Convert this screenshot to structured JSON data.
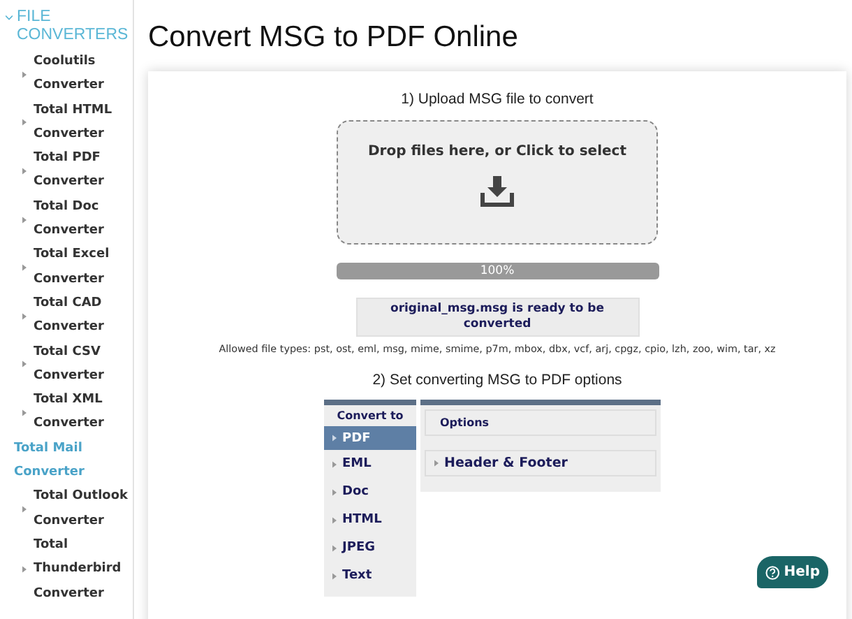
{
  "sidebar": {
    "title": "FILE CONVERTERS",
    "expanded": true,
    "children": [
      {
        "kind": "item",
        "label": "Coolutils Converter"
      },
      {
        "kind": "item",
        "label": "Total HTML Converter"
      },
      {
        "kind": "item",
        "label": "Total PDF Converter"
      },
      {
        "kind": "item",
        "label": "Total Doc Converter"
      },
      {
        "kind": "item",
        "label": "Total Excel Converter"
      },
      {
        "kind": "item",
        "label": "Total CAD Converter"
      },
      {
        "kind": "item",
        "label": "Total CSV Converter"
      },
      {
        "kind": "item",
        "label": "Total XML Converter"
      },
      {
        "kind": "category",
        "label": "Total Mail Converter",
        "children": [
          {
            "kind": "item",
            "label": "Total Outlook Converter"
          },
          {
            "kind": "item",
            "label": "Total Thunderbird Converter"
          }
        ]
      }
    ]
  },
  "page_title": "Convert MSG to PDF Online",
  "upload": {
    "heading": "1) Upload MSG file to convert",
    "dropzone_text": "Drop files here, or Click to select",
    "progress": {
      "level": 1,
      "label": "100%"
    },
    "message": "original_msg.msg is ready to be converted",
    "allowed_types": "Allowed file types: pst, ost, eml, msg, mime, smime, p7m, mbox, dbx, vcf, arj, cpgz, cpio, lzh, zoo, wim, tar, xz"
  },
  "options": {
    "heading": "2) Set converting MSG to PDF options",
    "convert_to": {
      "title": "Convert to",
      "formats": [
        {
          "label": "PDF",
          "selected": true
        },
        {
          "label": "EML",
          "selected": false
        },
        {
          "label": "Doc",
          "selected": false
        },
        {
          "label": "HTML",
          "selected": false
        },
        {
          "label": "JPEG",
          "selected": false
        },
        {
          "label": "Text",
          "selected": false
        }
      ]
    },
    "panel_title": "Options",
    "sections": [
      {
        "label": "Header & Footer",
        "expanded": false
      }
    ]
  },
  "help_button": "Help"
}
